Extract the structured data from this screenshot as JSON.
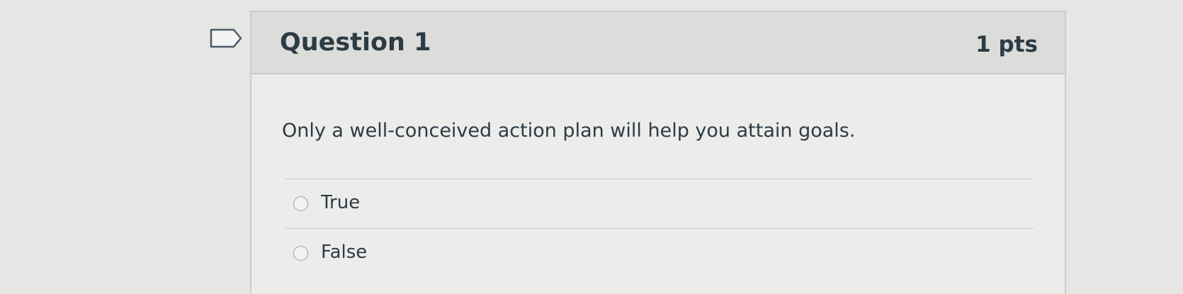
{
  "question": {
    "title": "Question 1",
    "points": "1 pts",
    "text": "Only a well-conceived action plan will help you attain goals.",
    "flag_icon": "flag-outline-icon",
    "answers": [
      {
        "label": "True",
        "selected": false
      },
      {
        "label": "False",
        "selected": false
      }
    ]
  },
  "colors": {
    "background": "#e6e6e4",
    "header": "#dcdcda",
    "text": "#2d3b45",
    "border": "#c7cdd1"
  }
}
